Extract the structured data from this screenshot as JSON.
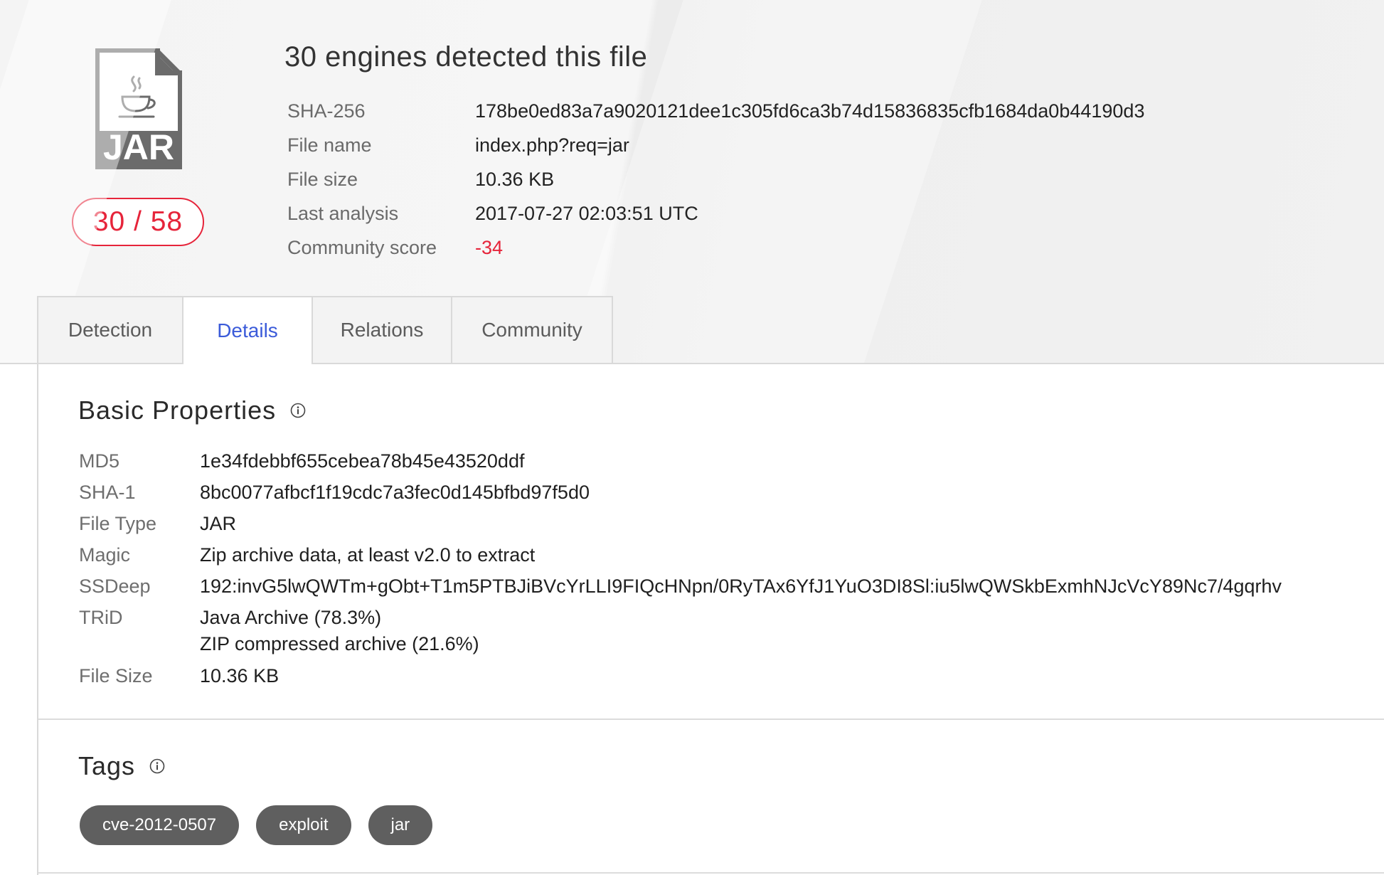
{
  "file_icon": {
    "label": "JAR"
  },
  "score": {
    "detections": "30 / 58"
  },
  "title": "30 engines detected this file",
  "meta": [
    {
      "label": "SHA-256",
      "value": "178be0ed83a7a9020121dee1c305fd6ca3b74d15836835cfb1684da0b44190d3"
    },
    {
      "label": "File name",
      "value": "index.php?req=jar"
    },
    {
      "label": "File size",
      "value": "10.36 KB"
    },
    {
      "label": "Last analysis",
      "value": "2017-07-27 02:03:51 UTC"
    },
    {
      "label": "Community score",
      "value": "-34"
    }
  ],
  "tabs": [
    {
      "label": "Detection"
    },
    {
      "label": "Details"
    },
    {
      "label": "Relations"
    },
    {
      "label": "Community"
    }
  ],
  "basic_properties": {
    "title": "Basic Properties",
    "rows": [
      {
        "label": "MD5",
        "value": "1e34fdebbf655cebea78b45e43520ddf"
      },
      {
        "label": "SHA-1",
        "value": "8bc0077afbcf1f19cdc7a3fec0d145bfbd97f5d0"
      },
      {
        "label": "File Type",
        "value": "JAR"
      },
      {
        "label": "Magic",
        "value": "Zip archive data, at least v2.0 to extract"
      },
      {
        "label": "SSDeep",
        "value": "192:invG5lwQWTm+gObt+T1m5PTBJiBVcYrLLI9FIQcHNpn/0RyTAx6YfJ1YuO3DI8Sl:iu5lwQWSkbExmhNJcVcY89Nc7/4gqrhv"
      },
      {
        "label": "TRiD",
        "values": [
          "Java Archive (78.3%)",
          "ZIP compressed archive (21.6%)"
        ]
      },
      {
        "label": "File Size",
        "value": "10.36 KB"
      }
    ]
  },
  "tags": {
    "title": "Tags",
    "items": [
      "cve-2012-0507",
      "exploit",
      "jar"
    ]
  },
  "colors": {
    "accent": "#3b5bd9",
    "danger": "#e6243a",
    "tag_bg": "#5f5f5f"
  }
}
